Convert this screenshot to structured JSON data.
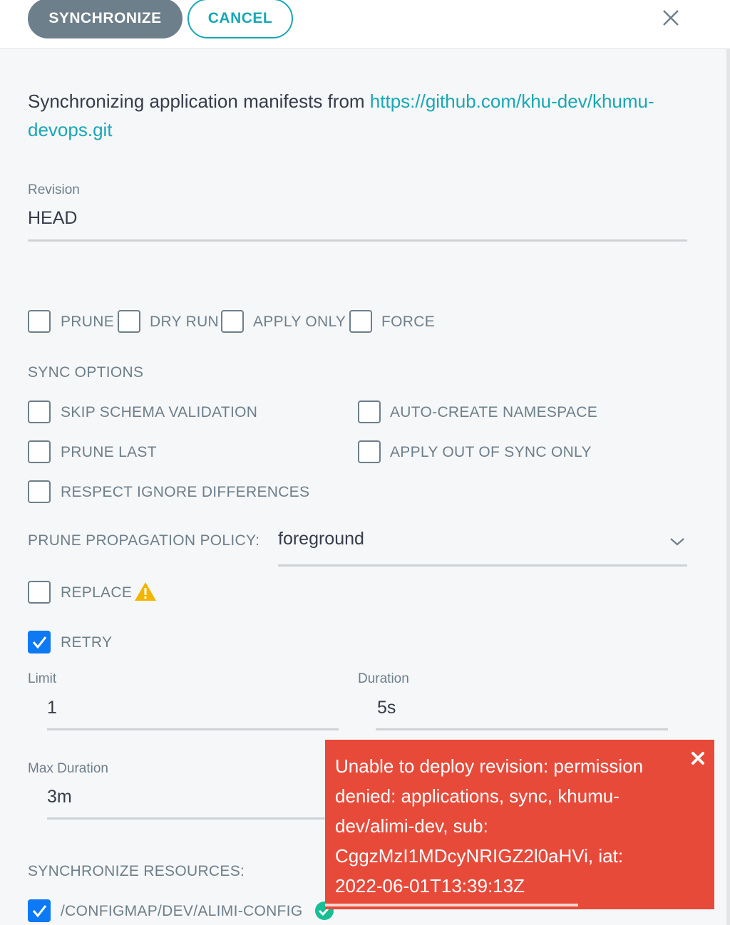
{
  "header": {
    "synchronize_label": "SYNCHRONIZE",
    "cancel_label": "CANCEL",
    "close_icon": "close-icon"
  },
  "intro": {
    "text": "Synchronizing application manifests from ",
    "repo_url": "https://github.com/khu-dev/khumu-devops.git"
  },
  "revision": {
    "label": "Revision",
    "value": "HEAD"
  },
  "flags": [
    {
      "label": "PRUNE",
      "checked": false
    },
    {
      "label": "DRY RUN",
      "checked": false
    },
    {
      "label": "APPLY ONLY",
      "checked": false
    },
    {
      "label": "FORCE",
      "checked": false
    }
  ],
  "sync_options": {
    "title": "SYNC OPTIONS",
    "items": [
      {
        "label": "SKIP SCHEMA VALIDATION",
        "checked": false
      },
      {
        "label": "AUTO-CREATE NAMESPACE",
        "checked": false
      },
      {
        "label": "PRUNE LAST",
        "checked": false
      },
      {
        "label": "APPLY OUT OF SYNC ONLY",
        "checked": false
      },
      {
        "label": "RESPECT IGNORE DIFFERENCES",
        "checked": false
      }
    ]
  },
  "prune_policy": {
    "label": "PRUNE PROPAGATION POLICY:",
    "value": "foreground",
    "icon": "chevron-down-icon"
  },
  "replace": {
    "label": "REPLACE",
    "checked": false,
    "icon": "warning-icon"
  },
  "retry": {
    "label": "RETRY",
    "checked": true,
    "limit_label": "Limit",
    "limit_value": "1",
    "duration_label": "Duration",
    "duration_value": "5s",
    "max_duration_label": "Max Duration",
    "max_duration_value": "3m"
  },
  "resources": {
    "title": "SYNCHRONIZE RESOURCES:",
    "items": [
      {
        "label": "/CONFIGMAP/DEV/ALIMI-CONFIG",
        "checked": true,
        "status_icon": "synced-check-icon"
      }
    ]
  },
  "toast": {
    "message": "Unable to deploy revision: permission denied: applications, sync, khumu-dev/alimi-dev, sub: CggzMzI1MDcyNRIGZ2l0aHVi, iat: 2022-06-01T13:39:13Z",
    "close_icon": "close-icon",
    "progress": 0.65
  },
  "colors": {
    "accent": "#18a7b5",
    "primary_button": "#6d7f8b",
    "checkbox_checked": "#0d79f2",
    "error_toast": "#e84a3a",
    "warning": "#f4b400",
    "success": "#18be94"
  }
}
